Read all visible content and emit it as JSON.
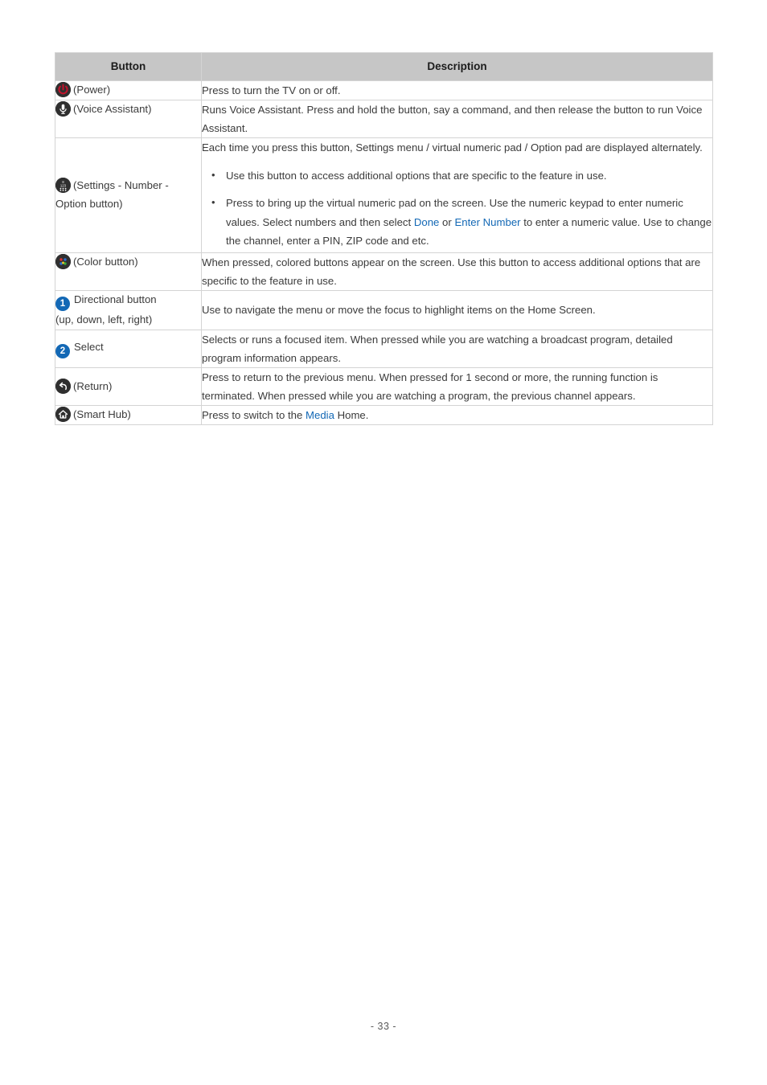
{
  "document": {
    "page_number_label": "- 33 -"
  },
  "table": {
    "headers": {
      "button": "Button",
      "description": "Description"
    },
    "rows": [
      {
        "icon": "power-icon",
        "label": "(Power)",
        "label_line2": "",
        "description": "Press to turn the TV on or off."
      },
      {
        "icon": "microphone-icon",
        "label": "(Voice Assistant)",
        "label_line2": "",
        "description": "Runs Voice Assistant. Press and hold the button, say a command, and then release the button to run Voice Assistant."
      },
      {
        "icon": "numeric-keypad-icon",
        "label": "(Settings - Number -",
        "label_line2": "Option button)",
        "description_intro": "Each time you press this button, Settings menu / virtual numeric pad / Option pad are displayed alternately.",
        "bullets": [
          {
            "text_before": "Use this button to access additional options that are specific to the feature in use.",
            "link1": "",
            "text_middle": "",
            "link2": "",
            "text_after": ""
          },
          {
            "text_before": "Press to bring up the virtual numeric pad on the screen. Use the numeric keypad to enter numeric values. Select numbers and then select ",
            "link1": "Done",
            "text_middle": " or ",
            "link2": "Enter Number",
            "text_after": " to enter a numeric value. Use to change the channel, enter a PIN, ZIP code and etc."
          }
        ]
      },
      {
        "icon": "color-button-icon",
        "label": "(Color button)",
        "label_line2": "",
        "description": "When pressed, colored buttons appear on the screen. Use this button to access additional options that are specific to the feature in use."
      },
      {
        "icon": "number-1-icon",
        "label": "Directional button",
        "label_line2": "(up, down, left, right)",
        "description": "Use to navigate the menu or move the focus to highlight items on the Home Screen."
      },
      {
        "icon": "number-2-icon",
        "label": "Select",
        "label_line2": "",
        "description": "Selects or runs a focused item. When pressed while you are watching a broadcast program, detailed program information appears."
      },
      {
        "icon": "return-arrow-icon",
        "label": "(Return)",
        "label_line2": "",
        "description": "Press to return to the previous menu. When pressed for 1 second or more, the running function is terminated. When pressed while you are watching a program, the previous channel appears."
      },
      {
        "icon": "home-icon",
        "label": "(Smart Hub)",
        "label_line2": "",
        "description_before": "Press to switch to the ",
        "description_link": "Media",
        "description_after": " Home."
      }
    ]
  },
  "icon_numbers": {
    "one": "1",
    "two": "2"
  },
  "colors": {
    "link": "#1368b5",
    "header_bg": "#c6c6c6",
    "icon_dark": "#2f2f2f",
    "power_red": "#c0142c",
    "dot_red": "#e03030",
    "dot_blue": "#2f6fd0",
    "dot_yellow": "#e8c52a",
    "dot_green": "#3aa83a"
  }
}
